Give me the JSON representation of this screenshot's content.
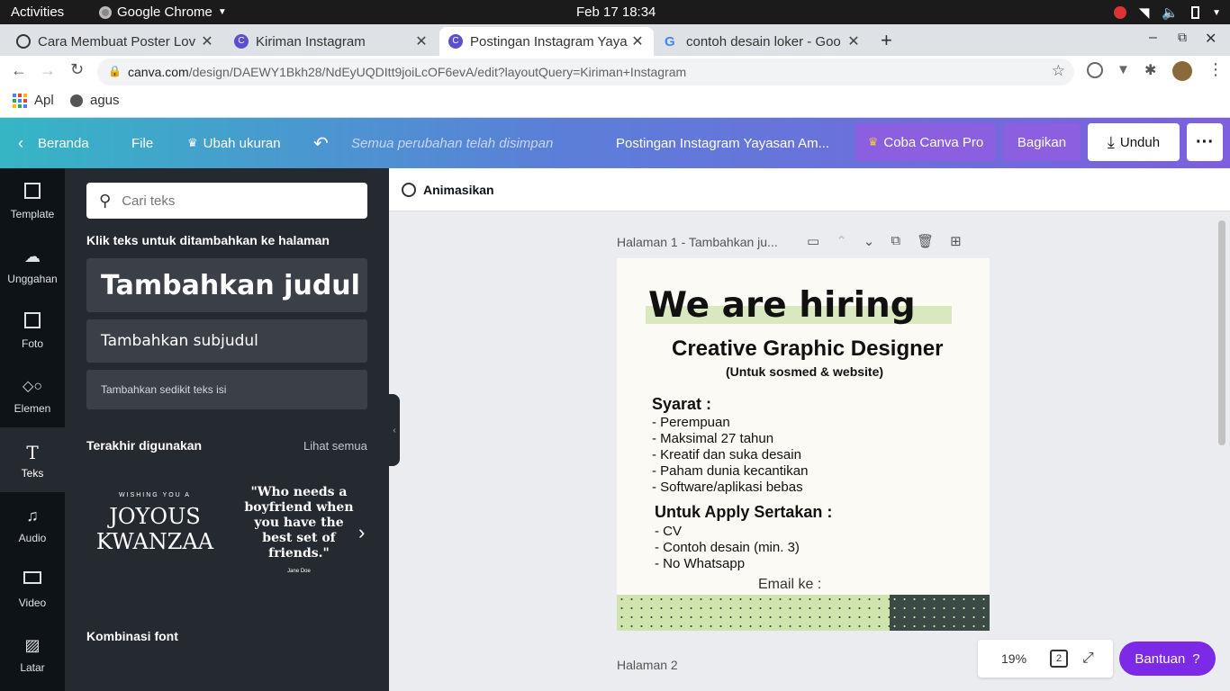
{
  "system": {
    "activities": "Activities",
    "app_name": "Google Chrome",
    "clock": "Feb 17  18:34"
  },
  "tabs": [
    {
      "title": "Cara Membuat Poster Lov"
    },
    {
      "title": "Kiriman Instagram"
    },
    {
      "title": "Postingan Instagram Yaya"
    },
    {
      "title": "contoh desain loker - Goo"
    }
  ],
  "address": {
    "domain": "canva.com",
    "path": "/design/DAEWY1Bkh28/NdEyUQDItt9joiLcOF6evA/edit?layoutQuery=Kiriman+Instagram"
  },
  "bookmarks": [
    {
      "label": "Apl"
    },
    {
      "label": "agus"
    }
  ],
  "header": {
    "home": "Beranda",
    "file": "File",
    "resize": "Ubah ukuran",
    "saved_status": "Semua perubahan telah disimpan",
    "doc_title": "Postingan Instagram Yayasan Am...",
    "try_pro": "Coba Canva Pro",
    "share": "Bagikan",
    "download": "Unduh"
  },
  "rail": [
    {
      "label": "Template",
      "icon": "template-icon"
    },
    {
      "label": "Unggahan",
      "icon": "upload-icon"
    },
    {
      "label": "Foto",
      "icon": "photo-icon"
    },
    {
      "label": "Elemen",
      "icon": "elements-icon"
    },
    {
      "label": "Teks",
      "icon": "text-icon"
    },
    {
      "label": "Audio",
      "icon": "audio-icon"
    },
    {
      "label": "Video",
      "icon": "video-icon"
    },
    {
      "label": "Latar",
      "icon": "background-icon"
    }
  ],
  "panel": {
    "search_placeholder": "Cari teks",
    "instruction": "Klik teks untuk ditambahkan ke halaman",
    "add_heading": "Tambahkan judul",
    "add_subheading": "Tambahkan subjudul",
    "add_body": "Tambahkan sedikit teks isi",
    "recent_title": "Terakhir digunakan",
    "see_all": "Lihat semua",
    "recent1": {
      "small": "WISHING YOU A",
      "line1": "JOYOUS",
      "line2": "KWANZAA"
    },
    "recent2": {
      "quote": "\"Who needs a boyfriend when you have the best set of friends.\"",
      "author": "Jane Doe"
    },
    "font_combo_title": "Kombinasi font"
  },
  "editor": {
    "animate": "Animasikan",
    "page1_label": "Halaman 1 - Tambahkan ju...",
    "page2_label": "Halaman 2",
    "zoom": "19%",
    "page_count": "2",
    "help": "Bantuan"
  },
  "design": {
    "headline": "We are hiring",
    "role": "Creative Graphic Designer",
    "role_note": "(Untuk sosmed & website)",
    "req_title": "Syarat :",
    "requirements": [
      "- Perempuan",
      "- Maksimal 27 tahun",
      "- Kreatif dan suka desain",
      "- Paham dunia kecantikan",
      "- Software/aplikasi bebas"
    ],
    "apply_title": "Untuk  Apply Sertakan :",
    "apply_items": [
      "- CV",
      "- Contoh desain (min. 3)",
      "- No Whatsapp"
    ],
    "email_label": "Email ke :"
  },
  "colors": {
    "header_gradient_start": "#35b6c5",
    "header_gradient_end": "#7d5fe0",
    "pro_button": "#8b5fe0",
    "help_button": "#7d2ae8",
    "design_highlight": "#d9e8bf",
    "design_footer_green": "#cfe3ad",
    "design_footer_dark": "#3c4a45"
  }
}
